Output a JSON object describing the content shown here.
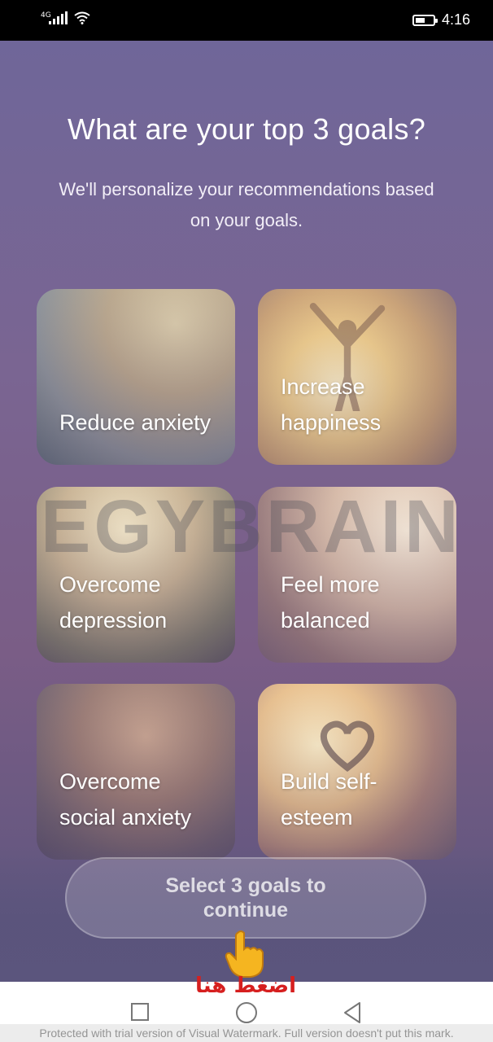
{
  "status_bar": {
    "network": "4G",
    "time": "4:16",
    "battery_level": 0.55,
    "icons": [
      "signal-icon",
      "wifi-icon",
      "battery-icon"
    ]
  },
  "screen": {
    "title": "What are your top 3 goals?",
    "subtitle": "We'll personalize your recommendations based on your goals."
  },
  "goals": [
    {
      "label": "Reduce anxiety"
    },
    {
      "label": "Increase happiness"
    },
    {
      "label": "Overcome depression"
    },
    {
      "label": "Feel more balanced"
    },
    {
      "label": "Overcome social anxiety"
    },
    {
      "label": "Build self-esteem"
    }
  ],
  "watermark_overlay": "EGYBRAIN",
  "continue_button": {
    "label": "Select 3 goals to continue"
  },
  "annotation": {
    "text": "اضغط هنا",
    "color": "#d61f1f"
  },
  "nav_bar": {
    "icons": [
      "recent-apps-icon",
      "home-icon",
      "back-icon"
    ]
  },
  "footer_note": "Protected with trial version of Visual Watermark. Full version doesn't put this mark."
}
